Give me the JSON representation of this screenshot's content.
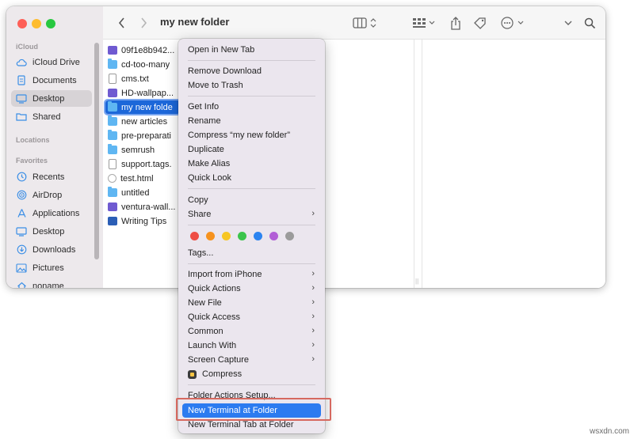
{
  "window": {
    "title": "my new folder"
  },
  "sidebar": {
    "sections": {
      "icloud": "iCloud",
      "locations": "Locations",
      "favorites": "Favorites"
    },
    "icloud_items": [
      {
        "label": "iCloud Drive",
        "icon": "cloud-icon"
      },
      {
        "label": "Documents",
        "icon": "document-icon"
      },
      {
        "label": "Desktop",
        "icon": "desktop-icon",
        "active": true
      },
      {
        "label": "Shared",
        "icon": "shared-folder-icon"
      }
    ],
    "favorite_items": [
      {
        "label": "Recents",
        "icon": "clock-icon"
      },
      {
        "label": "AirDrop",
        "icon": "airdrop-icon"
      },
      {
        "label": "Applications",
        "icon": "applications-icon"
      },
      {
        "label": "Desktop",
        "icon": "desktop-icon"
      },
      {
        "label": "Downloads",
        "icon": "download-icon"
      },
      {
        "label": "Pictures",
        "icon": "pictures-icon"
      },
      {
        "label": "noname",
        "icon": "home-icon"
      }
    ]
  },
  "files": [
    {
      "name": "09f1e8b942...",
      "type": "image"
    },
    {
      "name": "cd-too-many",
      "type": "folder"
    },
    {
      "name": "cms.txt",
      "type": "doc"
    },
    {
      "name": "HD-wallpap...",
      "type": "image"
    },
    {
      "name": "my new folde",
      "type": "folder",
      "selected": true
    },
    {
      "name": "new articles",
      "type": "folder"
    },
    {
      "name": "pre-preparati",
      "type": "folder"
    },
    {
      "name": "semrush",
      "type": "folder"
    },
    {
      "name": "support.tags.",
      "type": "doc"
    },
    {
      "name": "test.html",
      "type": "web"
    },
    {
      "name": "untitled",
      "type": "folder"
    },
    {
      "name": "ventura-wall...",
      "type": "image"
    },
    {
      "name": "Writing Tips",
      "type": "word"
    }
  ],
  "context_menu": {
    "items": {
      "open_new_tab": "Open in New Tab",
      "remove_download": "Remove Download",
      "move_to_trash": "Move to Trash",
      "get_info": "Get Info",
      "rename": "Rename",
      "compress_folder": "Compress “my new folder”",
      "duplicate": "Duplicate",
      "make_alias": "Make Alias",
      "quick_look": "Quick Look",
      "copy": "Copy",
      "share": "Share",
      "tags": "Tags...",
      "import_iphone": "Import from iPhone",
      "quick_actions": "Quick Actions",
      "new_file": "New File",
      "quick_access": "Quick Access",
      "common": "Common",
      "launch_with": "Launch With",
      "screen_capture": "Screen Capture",
      "compress": "Compress",
      "folder_actions_setup": "Folder Actions Setup...",
      "new_terminal_at_folder": "New Terminal at Folder",
      "new_terminal_tab_at_folder": "New Terminal Tab at Folder"
    },
    "tag_colors": [
      "#ee4d44",
      "#f6921e",
      "#f7c624",
      "#3bc44b",
      "#2c84f0",
      "#b25fd6",
      "#9b9b9b"
    ],
    "highlight_color": "#2c7bf0"
  },
  "watermark": "wsxdn.com"
}
